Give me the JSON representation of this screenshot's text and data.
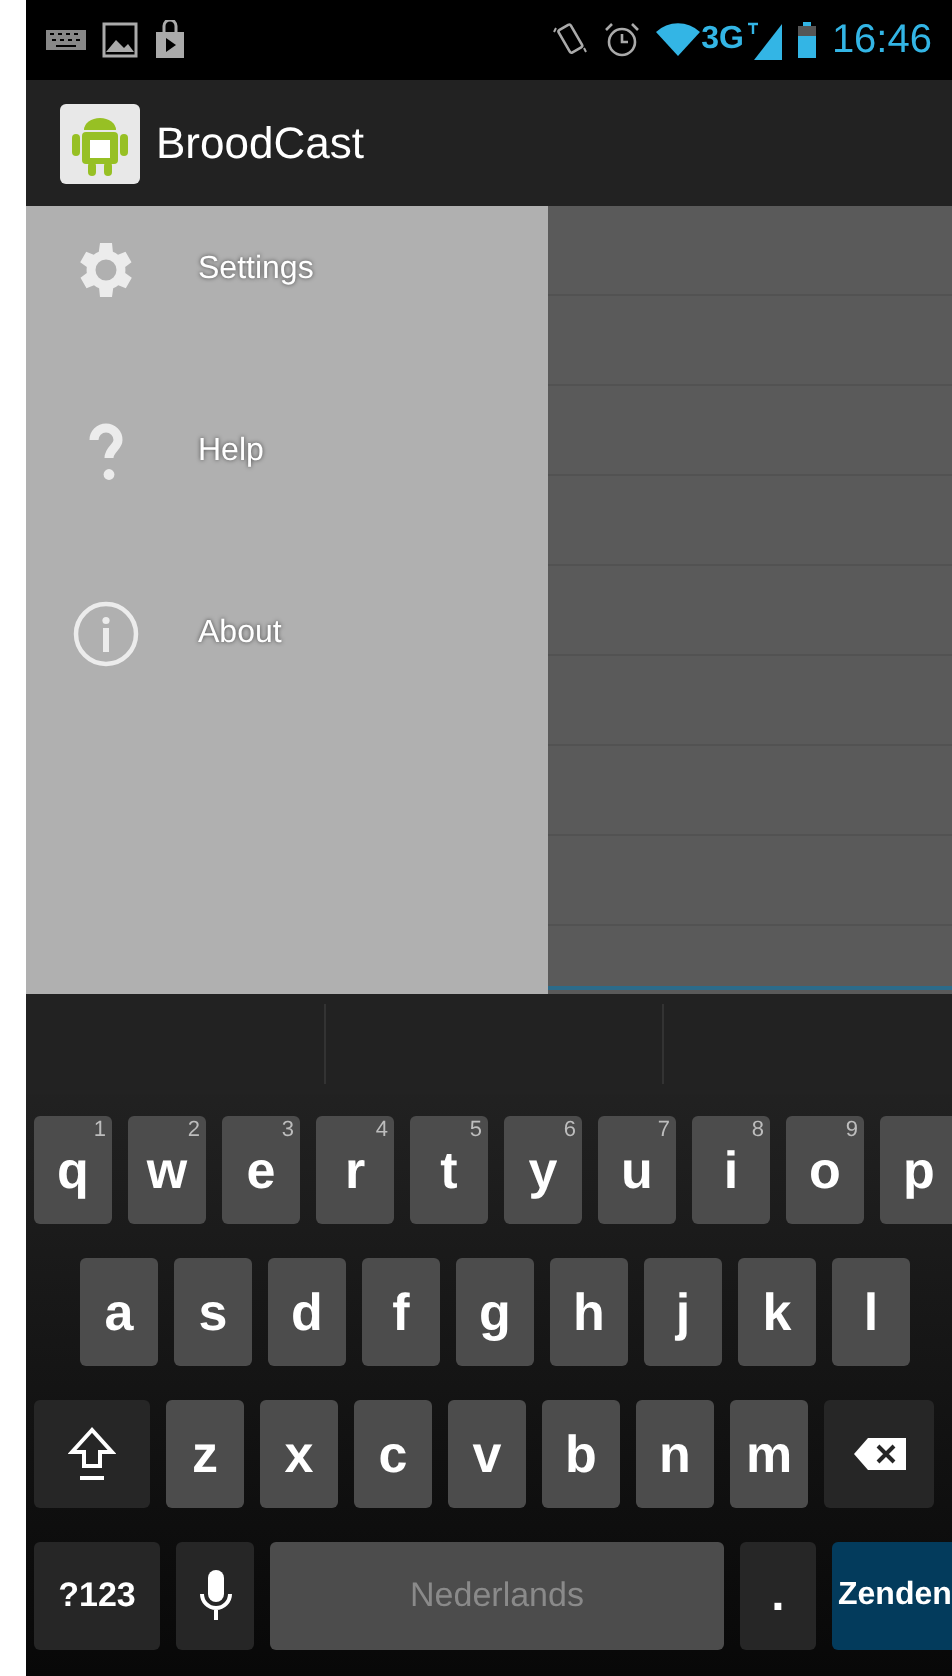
{
  "status_bar": {
    "network": "3G",
    "time": "16:46"
  },
  "action_bar": {
    "title": "BroodCast"
  },
  "drawer": {
    "items": [
      {
        "kind": "settings",
        "label": "Settings"
      },
      {
        "kind": "help",
        "label": "Help"
      },
      {
        "kind": "info",
        "label": "About"
      }
    ]
  },
  "keyboard": {
    "rows": [
      {
        "keys": [
          {
            "kind": "letter",
            "label": "q",
            "hint": "1"
          },
          {
            "kind": "letter",
            "label": "w",
            "hint": "2"
          },
          {
            "kind": "letter",
            "label": "e",
            "hint": "3"
          },
          {
            "kind": "letter",
            "label": "r",
            "hint": "4"
          },
          {
            "kind": "letter",
            "label": "t",
            "hint": "5"
          },
          {
            "kind": "letter",
            "label": "y",
            "hint": "6"
          },
          {
            "kind": "letter",
            "label": "u",
            "hint": "7"
          },
          {
            "kind": "letter",
            "label": "i",
            "hint": "8"
          },
          {
            "kind": "letter",
            "label": "o",
            "hint": "9"
          },
          {
            "kind": "letter",
            "label": "p"
          }
        ]
      },
      {
        "keys": [
          {
            "kind": "letter",
            "label": "a"
          },
          {
            "kind": "letter",
            "label": "s"
          },
          {
            "kind": "letter",
            "label": "d"
          },
          {
            "kind": "letter",
            "label": "f"
          },
          {
            "kind": "letter",
            "label": "g"
          },
          {
            "kind": "letter",
            "label": "h"
          },
          {
            "kind": "letter",
            "label": "j"
          },
          {
            "kind": "letter",
            "label": "k"
          },
          {
            "kind": "letter",
            "label": "l"
          }
        ]
      },
      {
        "keys": [
          {
            "kind": "shift"
          },
          {
            "kind": "letter",
            "label": "z"
          },
          {
            "kind": "letter",
            "label": "x"
          },
          {
            "kind": "letter",
            "label": "c"
          },
          {
            "kind": "letter",
            "label": "v"
          },
          {
            "kind": "letter",
            "label": "b"
          },
          {
            "kind": "letter",
            "label": "n"
          },
          {
            "kind": "letter",
            "label": "m"
          },
          {
            "kind": "backspace"
          }
        ]
      },
      {
        "keys": [
          {
            "kind": "symbols",
            "label": "?123"
          },
          {
            "kind": "mic"
          },
          {
            "kind": "space",
            "label": "Nederlands"
          },
          {
            "kind": "period",
            "label": "."
          },
          {
            "kind": "action",
            "label": "Zenden"
          }
        ]
      }
    ]
  }
}
